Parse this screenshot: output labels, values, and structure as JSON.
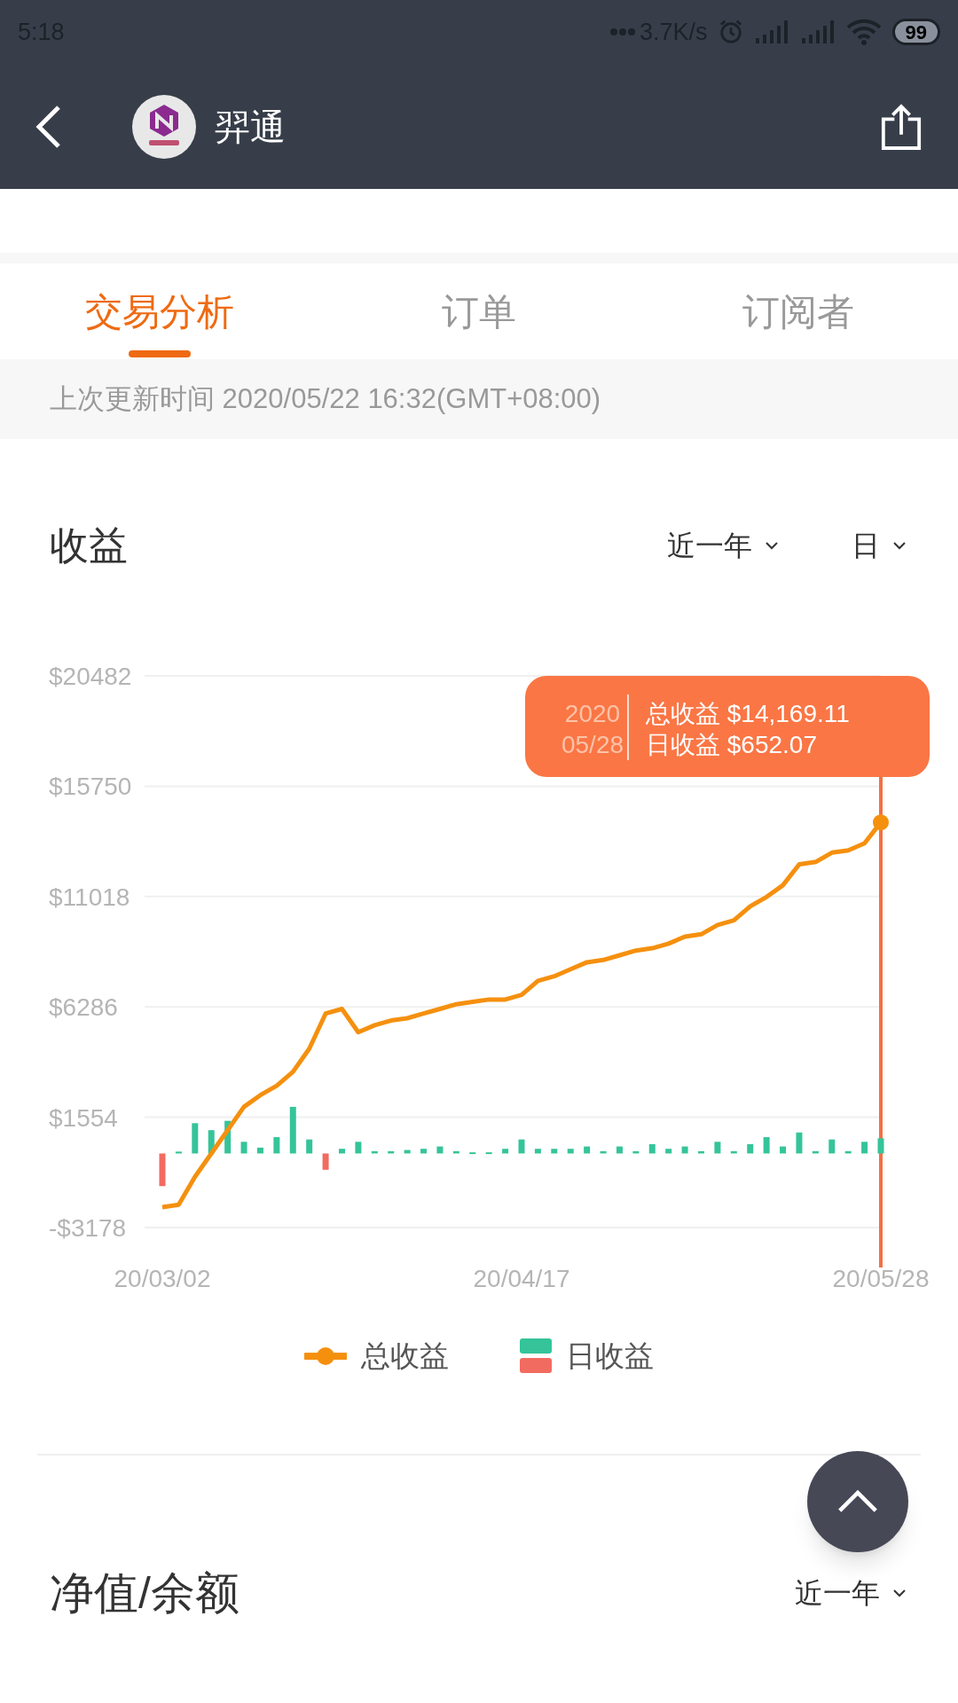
{
  "status_bar": {
    "time": "5:18",
    "speed": "3.7K/s",
    "battery": "99"
  },
  "header": {
    "title": "羿通"
  },
  "tabs": [
    {
      "label": "交易分析",
      "selected": true
    },
    {
      "label": "订单",
      "selected": false
    },
    {
      "label": "订阅者",
      "selected": false
    }
  ],
  "update_note": "上次更新时间 2020/05/22 16:32(GMT+08:00)",
  "earnings": {
    "title": "收益",
    "filters": [
      "近一年",
      "日"
    ],
    "chart_data": {
      "type": "line",
      "categories": [
        "20/03/02",
        null,
        null,
        null,
        null,
        null,
        null,
        null,
        null,
        null,
        null,
        null,
        null,
        null,
        null,
        null,
        null,
        null,
        null,
        null,
        null,
        null,
        "20/04/17",
        null,
        null,
        null,
        null,
        null,
        null,
        null,
        null,
        null,
        null,
        null,
        null,
        null,
        null,
        null,
        null,
        null,
        null,
        null,
        null,
        null,
        "20/05/28"
      ],
      "grid": true,
      "ylim": [
        -3178,
        20482
      ],
      "yticks": [
        {
          "value": -3178,
          "label": "-$3178"
        },
        {
          "value": 1554,
          "label": "$1554"
        },
        {
          "value": 6286,
          "label": "$6286"
        },
        {
          "value": 11018,
          "label": "$11018"
        },
        {
          "value": 15750,
          "label": "$15750"
        },
        {
          "value": 20482,
          "label": "$20482"
        }
      ],
      "series": [
        {
          "name": "总收益",
          "type": "line",
          "color": "#f5900f",
          "values": [
            -2300,
            -2200,
            -1000,
            0,
            1000,
            2000,
            2500,
            2900,
            3500,
            4500,
            6000,
            6200,
            5200,
            5500,
            5700,
            5800,
            6000,
            6200,
            6400,
            6500,
            6600,
            6600,
            6800,
            7400,
            7600,
            7900,
            8200,
            8300,
            8500,
            8700,
            8800,
            9000,
            9300,
            9400,
            9800,
            10000,
            10600,
            11000,
            11500,
            12400,
            12500,
            12900,
            13000,
            13300,
            14200
          ]
        },
        {
          "name": "日收益",
          "type": "bar",
          "color": "#35c49a",
          "values": [
            null,
            80,
            1300,
            1000,
            1400,
            500,
            250,
            700,
            2000,
            600,
            null,
            200,
            500,
            100,
            100,
            150,
            200,
            300,
            100,
            50,
            50,
            200,
            600,
            200,
            200,
            200,
            300,
            100,
            300,
            100,
            400,
            200,
            300,
            100,
            500,
            100,
            400,
            700,
            300,
            900,
            100,
            600,
            100,
            500,
            650
          ]
        },
        {
          "type": "bar",
          "color": "#f26b61",
          "values": [
            -1400,
            null,
            null,
            null,
            null,
            null,
            null,
            null,
            null,
            null,
            -700,
            null,
            null,
            null,
            null,
            null,
            null,
            null,
            null,
            null,
            null,
            null,
            null,
            null,
            null,
            null,
            null,
            null,
            null,
            null,
            null,
            null,
            null,
            null,
            null,
            null,
            null,
            null,
            null,
            null,
            null,
            null,
            null,
            null,
            null
          ]
        }
      ]
    },
    "tooltip": {
      "year": "2020",
      "date": "05/28",
      "lines": [
        "总收益 $14,169.11",
        "日收益 $652.07"
      ]
    }
  },
  "net_value": {
    "title": "净值/余额",
    "filter": "近一年"
  }
}
